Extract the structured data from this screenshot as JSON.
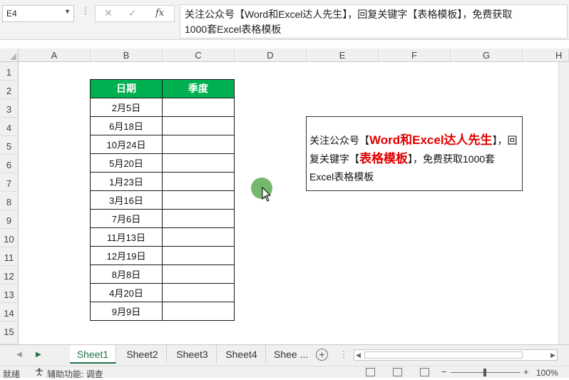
{
  "formula_bar": {
    "name_box": "E4",
    "cancel_symbol": "✕",
    "enter_symbol": "✓",
    "fx_symbol": "fx",
    "content_line1": "关注公众号【Word和Excel达人先生】，回复关键字【表格模板】，免费获取",
    "content_line2": "1000套Excel表格模板"
  },
  "columns": [
    "A",
    "B",
    "C",
    "D",
    "E",
    "F",
    "G",
    "H"
  ],
  "rows": [
    "1",
    "2",
    "3",
    "4",
    "5",
    "6",
    "7",
    "8",
    "9",
    "10",
    "11",
    "12",
    "13",
    "14",
    "15"
  ],
  "table": {
    "headers": [
      "日期",
      "季度"
    ],
    "dates": [
      "2月5日",
      "6月18日",
      "10月24日",
      "5月20日",
      "1月23日",
      "3月16日",
      "7月6日",
      "11月13日",
      "12月19日",
      "8月8日",
      "4月20日",
      "9月9日"
    ],
    "header_color": "#00b050"
  },
  "textbox": {
    "part1": "关注公众号【",
    "part2": "Word和Excel达人先生",
    "part3": "】，回复关键字【",
    "part4": "表格模板",
    "part5": "】，免费获取1000套Excel表格模板",
    "highlight_color": "#e00000"
  },
  "sheet_tabs": [
    "Sheet1",
    "Sheet2",
    "Sheet3",
    "Sheet4",
    "Shee ..."
  ],
  "active_sheet": "Sheet1",
  "status": {
    "ready": "就绪",
    "accessibility": "辅助功能: 调查",
    "zoom": "100%"
  }
}
